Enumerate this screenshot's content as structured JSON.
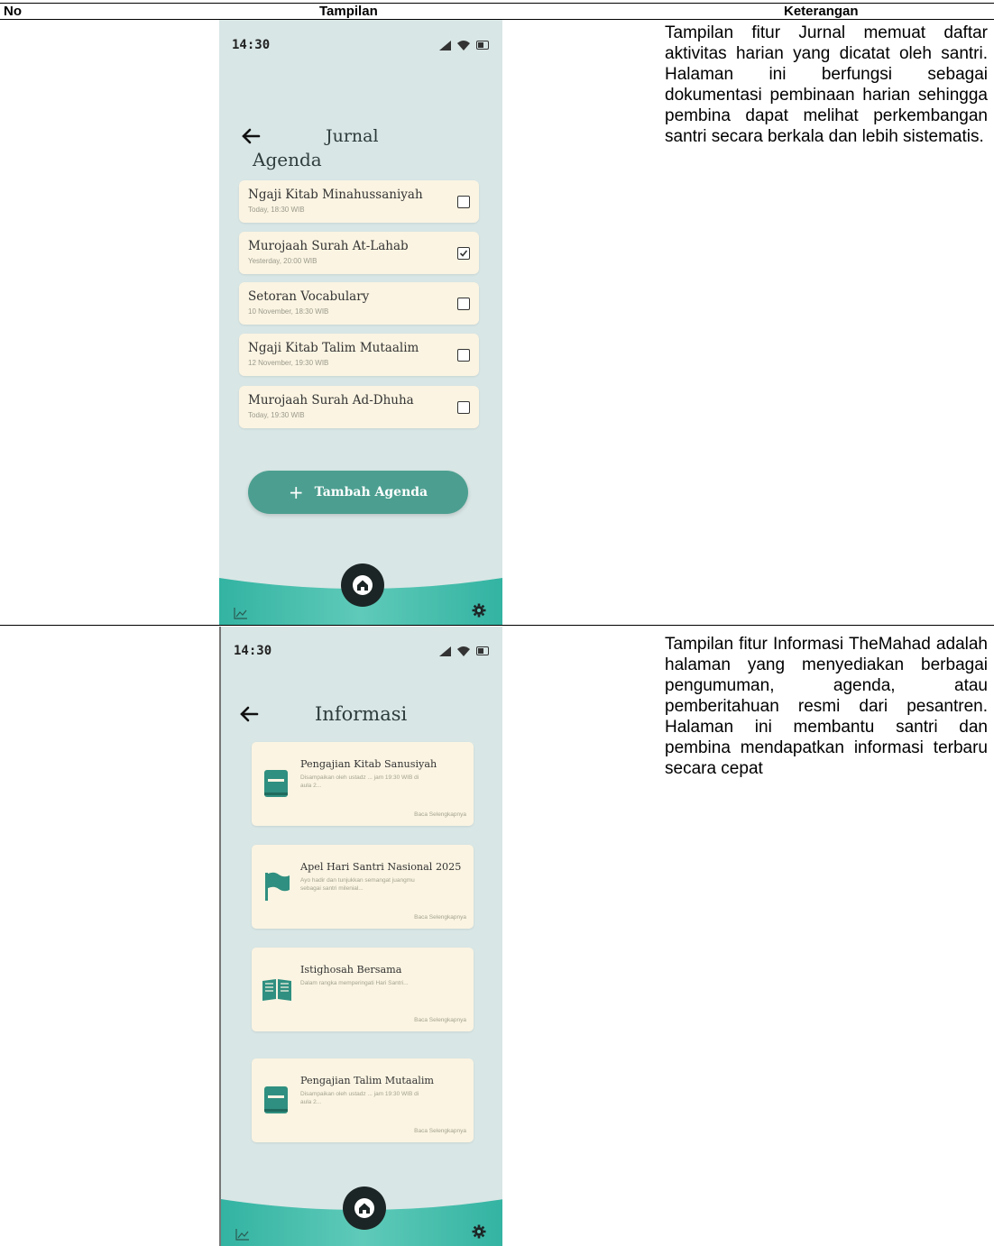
{
  "table": {
    "headers": [
      "No",
      "Tampilan",
      "Keterangan"
    ],
    "rows": [
      {
        "description": "Tampilan fitur Jurnal memuat daftar aktivitas harian yang dicatat oleh santri. Halaman ini berfungsi sebagai dokumentasi pembinaan harian sehingga pembina dapat melihat perkembangan santri secara berkala dan lebih sistematis."
      },
      {
        "description": "Tampilan fitur Informasi TheMahad adalah halaman yang menyediakan berbagai pengumuman, agenda, atau pemberitahuan resmi dari pesantren. Halaman ini membantu santri dan pembina mendapatkan informasi terbaru secara cepat"
      }
    ]
  },
  "jurnal_screen": {
    "status_time": "14:30",
    "title": "Jurnal",
    "section": "Agenda",
    "items": [
      {
        "title": "Ngaji Kitab Minahussaniyah",
        "subtitle": "Today, 18:30 WIB",
        "checked": false
      },
      {
        "title": "Murojaah Surah At-Lahab",
        "subtitle": "Yesterday, 20:00 WIB",
        "checked": true
      },
      {
        "title": "Setoran Vocabulary",
        "subtitle": "10 November, 18:30 WIB",
        "checked": false
      },
      {
        "title": "Ngaji Kitab Talim Mutaalim",
        "subtitle": "12 November, 19:30 WIB",
        "checked": false
      },
      {
        "title": "Murojaah Surah Ad-Dhuha",
        "subtitle": "Today, 19:30 WIB",
        "checked": false
      }
    ],
    "add_button": "Tambah Agenda",
    "plus": "+"
  },
  "informasi_screen": {
    "status_time": "14:30",
    "title": "Informasi",
    "cards": [
      {
        "icon": "book-icon",
        "title": "Pengajian Kitab Sanusiyah",
        "body": "Disampaikan oleh ustadz ... jam 19:30 WIB di aula 2...",
        "more": "Baca Selengkapnya"
      },
      {
        "icon": "flag-icon",
        "title": "Apel Hari Santri Nasional 2025",
        "body": "Ayo hadir dan tunjukkan semangat juangmu sebagai santri milenial...",
        "more": "Baca Selengkapnya"
      },
      {
        "icon": "open-book-icon",
        "title": "Istighosah Bersama",
        "body": "Dalam rangka memperingati Hari Santri...",
        "more": "Baca Selengkapnya"
      },
      {
        "icon": "book-icon",
        "title": "Pengajian Talim Mutaalim",
        "body": "Disampaikan oleh ustadz ... jam 19:30 WIB di aula 2...",
        "more": "Baca Selengkapnya"
      }
    ]
  },
  "colors": {
    "screen_bg": "#d8e6e5",
    "card_bg": "#fbf4e2",
    "accent": "#4c9f90",
    "nav_dark": "#1c2525"
  }
}
